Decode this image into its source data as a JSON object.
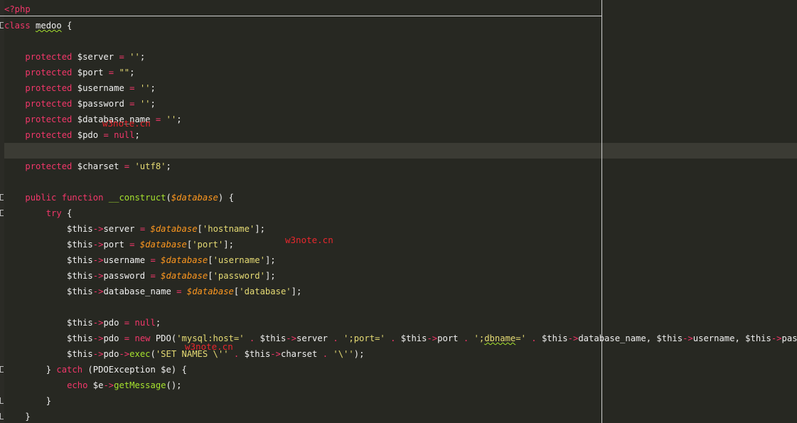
{
  "editor": {
    "open_tag": "<?php",
    "lines": [
      {
        "tokens": [
          {
            "t": "class",
            "c": "kw"
          },
          {
            "t": " "
          },
          {
            "t": "medoo",
            "c": "plain squiggle"
          },
          {
            "t": " {"
          }
        ]
      },
      {
        "tokens": []
      },
      {
        "tokens": [
          {
            "t": "    "
          },
          {
            "t": "protected",
            "c": "kw"
          },
          {
            "t": " $server "
          },
          {
            "t": "=",
            "c": "op"
          },
          {
            "t": " "
          },
          {
            "t": "''",
            "c": "str"
          },
          {
            "t": ";"
          }
        ]
      },
      {
        "tokens": [
          {
            "t": "    "
          },
          {
            "t": "protected",
            "c": "kw"
          },
          {
            "t": " $port "
          },
          {
            "t": "=",
            "c": "op"
          },
          {
            "t": " "
          },
          {
            "t": "\"\"",
            "c": "str"
          },
          {
            "t": ";"
          }
        ]
      },
      {
        "tokens": [
          {
            "t": "    "
          },
          {
            "t": "protected",
            "c": "kw"
          },
          {
            "t": " $username "
          },
          {
            "t": "=",
            "c": "op"
          },
          {
            "t": " "
          },
          {
            "t": "''",
            "c": "str"
          },
          {
            "t": ";"
          }
        ]
      },
      {
        "tokens": [
          {
            "t": "    "
          },
          {
            "t": "protected",
            "c": "kw"
          },
          {
            "t": " $password "
          },
          {
            "t": "=",
            "c": "op"
          },
          {
            "t": " "
          },
          {
            "t": "''",
            "c": "str"
          },
          {
            "t": ";"
          }
        ]
      },
      {
        "tokens": [
          {
            "t": "    "
          },
          {
            "t": "protected",
            "c": "kw"
          },
          {
            "t": " $database_name "
          },
          {
            "t": "=",
            "c": "op"
          },
          {
            "t": " "
          },
          {
            "t": "''",
            "c": "str"
          },
          {
            "t": ";"
          }
        ]
      },
      {
        "tokens": [
          {
            "t": "    "
          },
          {
            "t": "protected",
            "c": "kw"
          },
          {
            "t": " $pdo "
          },
          {
            "t": "=",
            "c": "op"
          },
          {
            "t": " "
          },
          {
            "t": "null",
            "c": "kw"
          },
          {
            "t": ";"
          }
        ]
      },
      {
        "tokens": [],
        "current": true
      },
      {
        "tokens": [
          {
            "t": "    "
          },
          {
            "t": "protected",
            "c": "kw"
          },
          {
            "t": " $charset "
          },
          {
            "t": "=",
            "c": "op"
          },
          {
            "t": " "
          },
          {
            "t": "'utf8'",
            "c": "str"
          },
          {
            "t": ";"
          }
        ]
      },
      {
        "tokens": []
      },
      {
        "tokens": [
          {
            "t": "    "
          },
          {
            "t": "public",
            "c": "kw"
          },
          {
            "t": " "
          },
          {
            "t": "function",
            "c": "kw"
          },
          {
            "t": " "
          },
          {
            "t": "__construct",
            "c": "fn"
          },
          {
            "t": "("
          },
          {
            "t": "$database",
            "c": "var"
          },
          {
            "t": ") {"
          }
        ]
      },
      {
        "tokens": [
          {
            "t": "        "
          },
          {
            "t": "try",
            "c": "kw"
          },
          {
            "t": " {"
          }
        ]
      },
      {
        "tokens": [
          {
            "t": "            $this"
          },
          {
            "t": "->",
            "c": "op"
          },
          {
            "t": "server "
          },
          {
            "t": "=",
            "c": "op"
          },
          {
            "t": " "
          },
          {
            "t": "$database",
            "c": "var"
          },
          {
            "t": "["
          },
          {
            "t": "'hostname'",
            "c": "str"
          },
          {
            "t": "];"
          }
        ]
      },
      {
        "tokens": [
          {
            "t": "            $this"
          },
          {
            "t": "->",
            "c": "op"
          },
          {
            "t": "port "
          },
          {
            "t": "=",
            "c": "op"
          },
          {
            "t": " "
          },
          {
            "t": "$database",
            "c": "var"
          },
          {
            "t": "["
          },
          {
            "t": "'port'",
            "c": "str"
          },
          {
            "t": "];"
          }
        ]
      },
      {
        "tokens": [
          {
            "t": "            $this"
          },
          {
            "t": "->",
            "c": "op"
          },
          {
            "t": "username "
          },
          {
            "t": "=",
            "c": "op"
          },
          {
            "t": " "
          },
          {
            "t": "$database",
            "c": "var"
          },
          {
            "t": "["
          },
          {
            "t": "'username'",
            "c": "str"
          },
          {
            "t": "];"
          }
        ]
      },
      {
        "tokens": [
          {
            "t": "            $this"
          },
          {
            "t": "->",
            "c": "op"
          },
          {
            "t": "password "
          },
          {
            "t": "=",
            "c": "op"
          },
          {
            "t": " "
          },
          {
            "t": "$database",
            "c": "var"
          },
          {
            "t": "["
          },
          {
            "t": "'password'",
            "c": "str"
          },
          {
            "t": "];"
          }
        ]
      },
      {
        "tokens": [
          {
            "t": "            $this"
          },
          {
            "t": "->",
            "c": "op"
          },
          {
            "t": "database_name "
          },
          {
            "t": "=",
            "c": "op"
          },
          {
            "t": " "
          },
          {
            "t": "$database",
            "c": "var"
          },
          {
            "t": "["
          },
          {
            "t": "'database'",
            "c": "str"
          },
          {
            "t": "];"
          }
        ]
      },
      {
        "tokens": []
      },
      {
        "tokens": [
          {
            "t": "            $this"
          },
          {
            "t": "->",
            "c": "op"
          },
          {
            "t": "pdo "
          },
          {
            "t": "=",
            "c": "op"
          },
          {
            "t": " "
          },
          {
            "t": "null",
            "c": "kw"
          },
          {
            "t": ";"
          }
        ]
      },
      {
        "tokens": [
          {
            "t": "            $this"
          },
          {
            "t": "->",
            "c": "op"
          },
          {
            "t": "pdo "
          },
          {
            "t": "=",
            "c": "op"
          },
          {
            "t": " "
          },
          {
            "t": "new",
            "c": "kw"
          },
          {
            "t": " PDO("
          },
          {
            "t": "'mysql:host='",
            "c": "str"
          },
          {
            "t": " "
          },
          {
            "t": ".",
            "c": "op"
          },
          {
            "t": " $this"
          },
          {
            "t": "->",
            "c": "op"
          },
          {
            "t": "server "
          },
          {
            "t": ".",
            "c": "op"
          },
          {
            "t": " "
          },
          {
            "t": "';port='",
            "c": "str"
          },
          {
            "t": " "
          },
          {
            "t": ".",
            "c": "op"
          },
          {
            "t": " $this"
          },
          {
            "t": "->",
            "c": "op"
          },
          {
            "t": "port "
          },
          {
            "t": ".",
            "c": "op"
          },
          {
            "t": " "
          },
          {
            "t": "';",
            "c": "str"
          },
          {
            "t": "dbname",
            "c": "str squiggle"
          },
          {
            "t": "='",
            "c": "str"
          },
          {
            "t": " "
          },
          {
            "t": ".",
            "c": "op"
          },
          {
            "t": " $this"
          },
          {
            "t": "->",
            "c": "op"
          },
          {
            "t": "database_name, $this"
          },
          {
            "t": "->",
            "c": "op"
          },
          {
            "t": "username, $this"
          },
          {
            "t": "->",
            "c": "op"
          },
          {
            "t": "password);"
          }
        ]
      },
      {
        "tokens": [
          {
            "t": "            $this"
          },
          {
            "t": "->",
            "c": "op"
          },
          {
            "t": "pdo"
          },
          {
            "t": "->",
            "c": "op"
          },
          {
            "t": "exec",
            "c": "fn"
          },
          {
            "t": "("
          },
          {
            "t": "'SET NAMES \\''",
            "c": "str"
          },
          {
            "t": " "
          },
          {
            "t": ".",
            "c": "op"
          },
          {
            "t": " $this"
          },
          {
            "t": "->",
            "c": "op"
          },
          {
            "t": "charset "
          },
          {
            "t": ".",
            "c": "op"
          },
          {
            "t": " "
          },
          {
            "t": "'\\''",
            "c": "str"
          },
          {
            "t": ");"
          }
        ]
      },
      {
        "tokens": [
          {
            "t": "        } "
          },
          {
            "t": "catch",
            "c": "kw"
          },
          {
            "t": " (PDOException $e) {"
          }
        ]
      },
      {
        "tokens": [
          {
            "t": "            "
          },
          {
            "t": "echo",
            "c": "kw"
          },
          {
            "t": " $e"
          },
          {
            "t": "->",
            "c": "op"
          },
          {
            "t": "getMessage",
            "c": "fn"
          },
          {
            "t": "();"
          }
        ]
      },
      {
        "tokens": [
          {
            "t": "        }"
          }
        ]
      },
      {
        "tokens": [
          {
            "t": "    }"
          }
        ]
      }
    ]
  },
  "watermarks": [
    "w3note.cn",
    "w3note.cn",
    "w3note.cn"
  ]
}
